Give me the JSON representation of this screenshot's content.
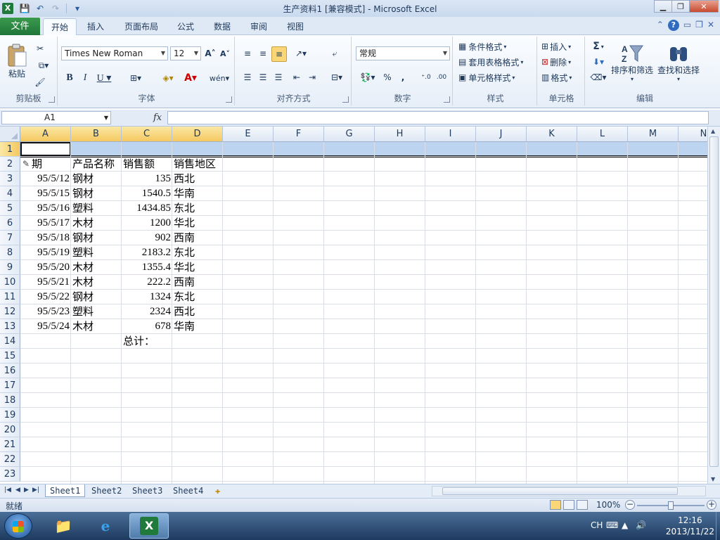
{
  "window": {
    "title": "生产资料1  [兼容模式] - Microsoft Excel",
    "app_badge": "X"
  },
  "ribbon_tabs": [
    "文件",
    "开始",
    "插入",
    "页面布局",
    "公式",
    "数据",
    "审阅",
    "视图"
  ],
  "active_tab": "开始",
  "ribbon": {
    "clipboard": {
      "label": "剪贴板",
      "paste": "粘贴"
    },
    "font": {
      "label": "字体",
      "font_name": "Times New Roman",
      "font_size": "12"
    },
    "alignment": {
      "label": "对齐方式"
    },
    "number": {
      "label": "数字",
      "format": "常规",
      "percent": "%",
      "comma": ","
    },
    "styles": {
      "label": "样式",
      "conditional": "条件格式",
      "table": "套用表格格式",
      "cell_styles": "单元格样式"
    },
    "cells": {
      "label": "单元格",
      "insert": "插入",
      "delete": "删除",
      "format": "格式"
    },
    "editing": {
      "label": "编辑",
      "sort_filter": "排序和筛选",
      "find_select": "查找和选择",
      "sigma": "Σ"
    }
  },
  "formula_bar": {
    "name_box": "A1",
    "fx": "fx",
    "content": ""
  },
  "columns": [
    "A",
    "B",
    "C",
    "D",
    "E",
    "F",
    "G",
    "H",
    "I",
    "J",
    "K",
    "L",
    "M",
    "N"
  ],
  "rows": [
    "1",
    "2",
    "3",
    "4",
    "5",
    "6",
    "7",
    "8",
    "9",
    "10",
    "11",
    "12",
    "13",
    "14",
    "15",
    "16",
    "17",
    "18",
    "19",
    "20",
    "21",
    "22",
    "23"
  ],
  "headers": {
    "a": "期",
    "b": "产品名称",
    "c": "销售额",
    "d": "销售地区"
  },
  "data_rows": [
    {
      "date": "95/5/12",
      "product": "钢材",
      "amount": "135",
      "region": "西北"
    },
    {
      "date": "95/5/15",
      "product": "钢材",
      "amount": "1540.5",
      "region": "华南"
    },
    {
      "date": "95/5/16",
      "product": "塑料",
      "amount": "1434.85",
      "region": "东北"
    },
    {
      "date": "95/5/17",
      "product": "木材",
      "amount": "1200",
      "region": "华北"
    },
    {
      "date": "95/5/18",
      "product": "钢材",
      "amount": "902",
      "region": "西南"
    },
    {
      "date": "95/5/19",
      "product": "塑料",
      "amount": "2183.2",
      "region": "东北"
    },
    {
      "date": "95/5/20",
      "product": "木材",
      "amount": "1355.4",
      "region": "华北"
    },
    {
      "date": "95/5/21",
      "product": "木材",
      "amount": "222.2",
      "region": "西南"
    },
    {
      "date": "95/5/22",
      "product": "钢材",
      "amount": "1324",
      "region": "东北"
    },
    {
      "date": "95/5/23",
      "product": "塑料",
      "amount": "2324",
      "region": "西北"
    },
    {
      "date": "95/5/24",
      "product": "木材",
      "amount": "678",
      "region": "华南"
    }
  ],
  "total_label": "总计：",
  "sheets": [
    "Sheet1",
    "Sheet2",
    "Sheet3",
    "Sheet4"
  ],
  "active_sheet": "Sheet1",
  "status": {
    "text": "就绪",
    "zoom": "100%"
  },
  "taskbar": {
    "lang": "CH",
    "time": "12:16",
    "date": "2013/11/22"
  },
  "colors": {
    "file_tab": "#21763a",
    "selection": "#bcd4f0",
    "header_highlight": "#f4c860"
  }
}
